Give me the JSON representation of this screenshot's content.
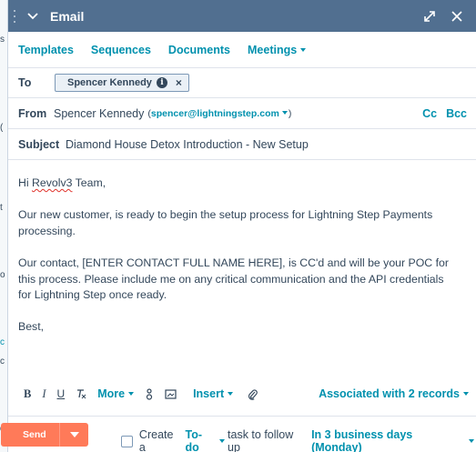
{
  "header": {
    "title": "Email"
  },
  "tabs": [
    {
      "label": "Templates"
    },
    {
      "label": "Sequences"
    },
    {
      "label": "Documents"
    },
    {
      "label": "Meetings"
    }
  ],
  "to": {
    "label": "To",
    "recipient": "Spencer Kennedy"
  },
  "from": {
    "label": "From",
    "name": "Spencer Kennedy",
    "email": "spencer@lightningstep.com",
    "cc": "Cc",
    "bcc": "Bcc"
  },
  "subject": {
    "label": "Subject",
    "value": "Diamond House Detox Introduction - New Setup"
  },
  "body": {
    "greeting_pre": "Hi ",
    "greeting_name": "Revolv3",
    "greeting_post": " Team,",
    "p2": "Our new customer, is ready to begin the setup process for Lightning Step Payments processing.",
    "p3": "Our contact, [ENTER CONTACT FULL NAME HERE], is CC'd and will be your POC for this process. Please include me on any critical communication and the API credentials for Lightning Step once ready.",
    "signoff": "Best,"
  },
  "toolbar": {
    "bold": "B",
    "italic": "I",
    "underline": "U",
    "clear_format": "Tx",
    "more": "More",
    "insert": "Insert",
    "associated": "Associated with 2 records"
  },
  "footer": {
    "send": "Send",
    "task_pre": "Create a",
    "task_type": "To-do",
    "task_mid": "task to follow up",
    "task_when": "In 3 business days (Monday)"
  },
  "colors": {
    "header_bg": "#516f90",
    "link": "#0091ae",
    "send": "#ff7a59",
    "text": "#33475b"
  }
}
